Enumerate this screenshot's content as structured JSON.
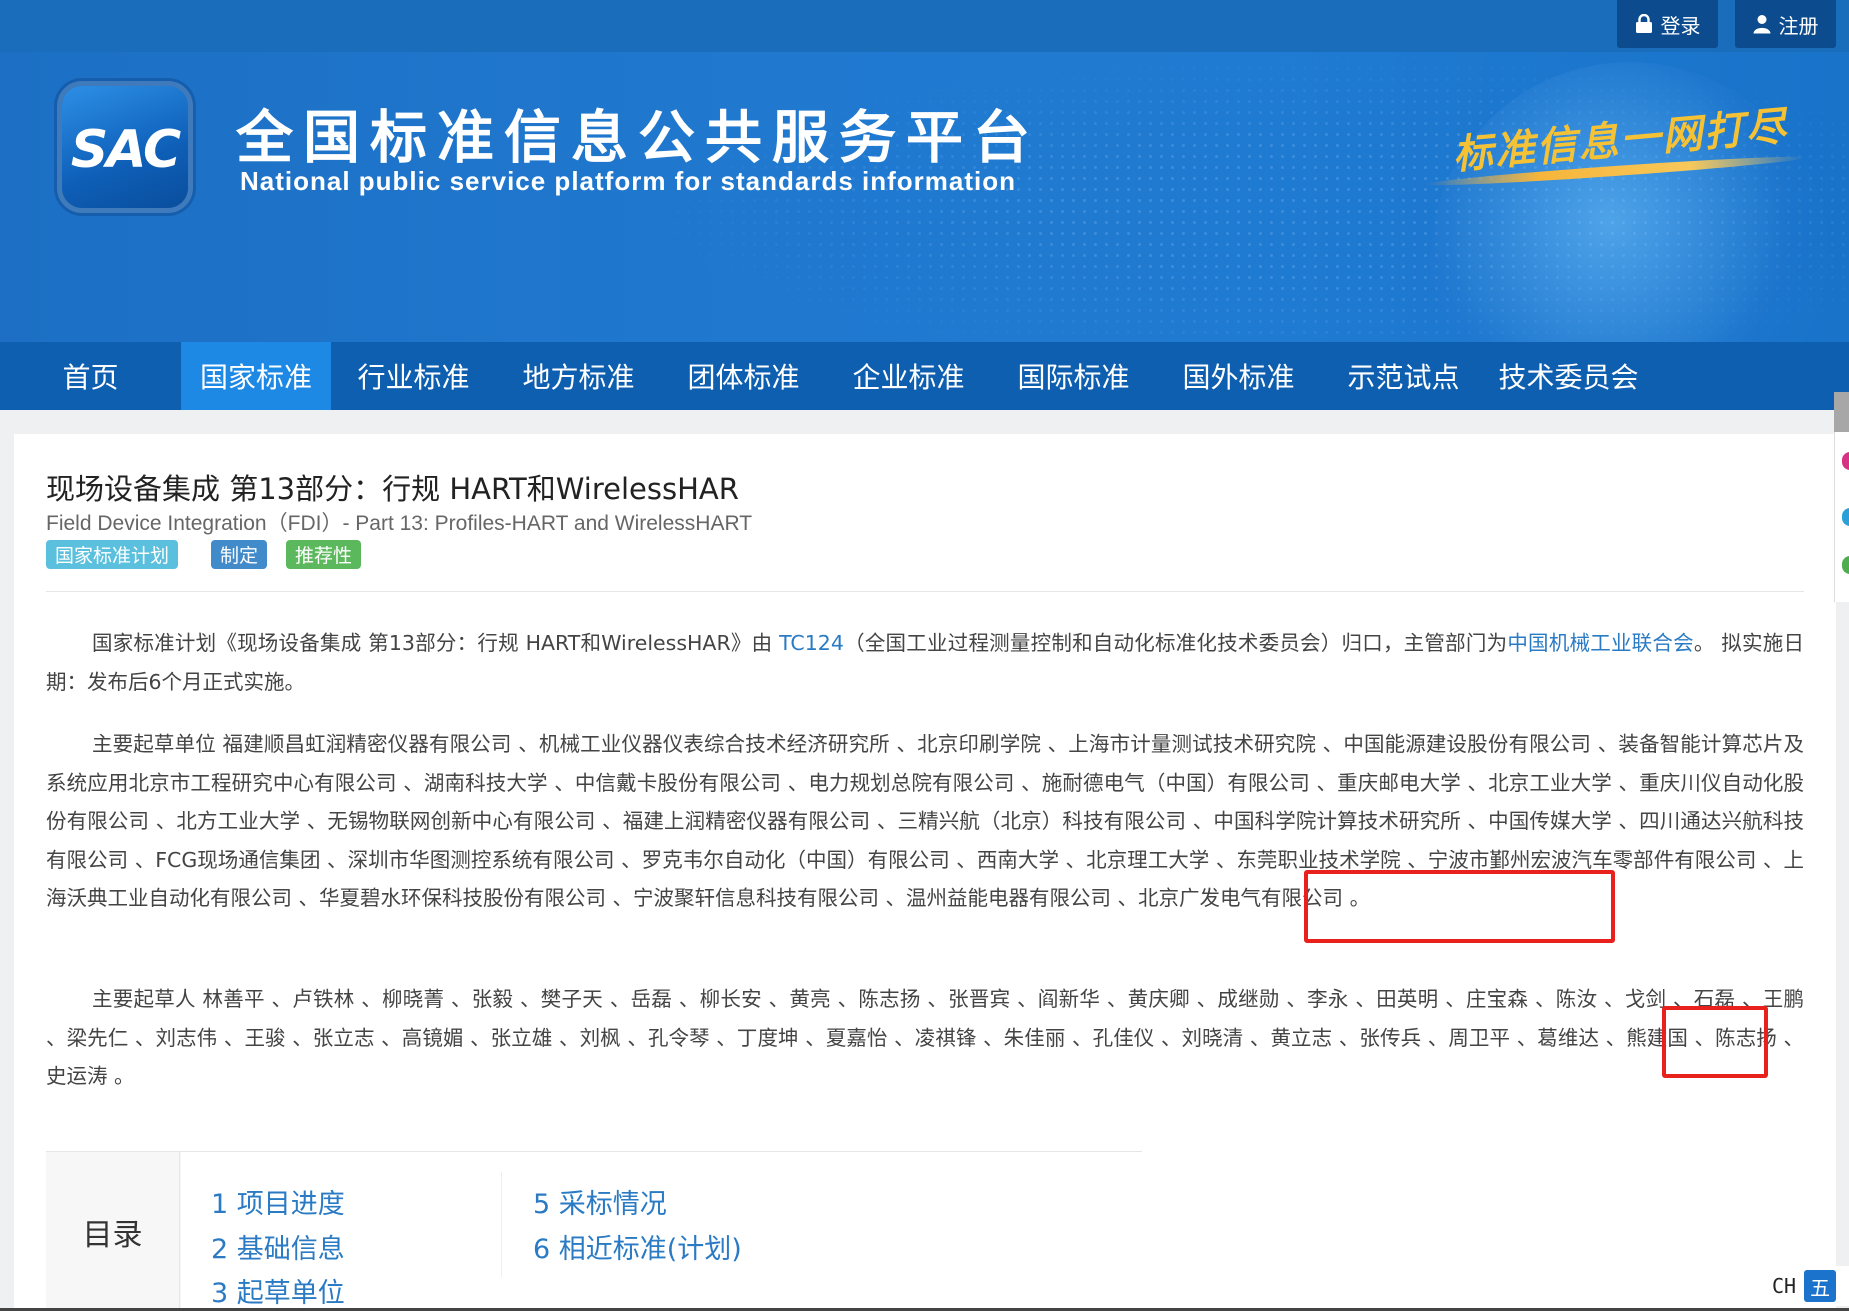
{
  "topbar": {
    "login_label": "登录",
    "register_label": "注册"
  },
  "banner": {
    "logo_text": "SAC",
    "title_cn": "全国标准信息公共服务平台",
    "title_en": "National public service platform  for standards information",
    "slogan": "标准信息一网打尽"
  },
  "nav": {
    "items": [
      "首页",
      "国家标准",
      "行业标准",
      "地方标准",
      "团体标准",
      "企业标准",
      "国际标准",
      "国外标准",
      "示范试点",
      "技术委员会"
    ],
    "active": "国家标准"
  },
  "doc": {
    "title": "现场设备集成 第13部分：行规 HART和WirelessHAR",
    "subtitle": "Field Device Integration（FDI）- Part 13: Profiles-HART and WirelessHART",
    "badges": [
      "国家标准计划",
      "制定",
      "推荐性"
    ]
  },
  "intro": {
    "text_a": "国家标准计划《现场设备集成 第13部分：行规 HART和WirelessHAR》由 ",
    "tc_link": "TC124",
    "text_b": "（全国工业过程测量控制和自动化标准化技术委员会）归口，主管部门为",
    "dept_link": "中国机械工业联合会",
    "text_c": "。 拟实施日期：发布后6个月正式实施。"
  },
  "drafting_units": {
    "label": "主要起草单位",
    "list": "福建顺昌虹润精密仪器有限公司 、机械工业仪器仪表综合技术经济研究所 、北京印刷学院 、上海市计量测试技术研究院 、中国能源建设股份有限公司 、装备智能计算芯片及系统应用北京市工程研究中心有限公司 、湖南科技大学 、中信戴卡股份有限公司 、电力规划总院有限公司 、施耐德电气（中国）有限公司 、重庆邮电大学 、北京工业大学 、重庆川仪自动化股份有限公司 、北方工业大学 、无锡物联网创新中心有限公司 、福建上润精密仪器有限公司 、三精兴航（北京）科技有限公司 、中国科学院计算技术研究所 、中国传媒大学 、四川通达兴航科技有限公司 、FCG现场通信集团 、深圳市华图测控系统有限公司 、罗克韦尔自动化（中国）有限公司 、西南大学 、北京理工大学 、东莞职业技术学院 、宁波市鄞州宏波汽车零部件有限公司 、上海沃典工业自动化有限公司 、华夏碧水环保科技股份有限公司 、宁波聚轩信息科技有限公司 、温州益能电器有限公司 、北京广发电气有限公司 。"
  },
  "drafters": {
    "label": "主要起草人",
    "list": "林善平 、卢铁林 、柳晓菁 、张毅 、樊子天 、岳磊 、柳长安 、黄亮 、陈志扬 、张晋宾 、阎新华 、黄庆卿 、成继勋 、李永 、田英明 、庄宝森 、陈汝 、戈剑 、石磊 、王鹏 、梁先仁 、刘志伟 、王骏 、张立志 、高镜媚 、张立雄 、刘枫 、孔令琴 、丁度坤 、夏嘉怡 、凌祺锋 、朱佳丽 、孔佳仪 、刘晓清 、黄立志 、张传兵 、周卫平 、葛维达 、熊建国 、陈志扬 、史运涛 。"
  },
  "toc": {
    "heading": "目录",
    "items": [
      "1  项目进度",
      "2  基础信息",
      "3  起草单位",
      "5  采标情况",
      "6  相近标准(计划)"
    ]
  },
  "ime": {
    "lang": "CH",
    "mode": "五"
  },
  "colors": {
    "nav_bg": "#0f5fb0",
    "nav_active": "#1e88e5",
    "link": "#2a7ac4",
    "highlight_box": "#e8211c"
  }
}
